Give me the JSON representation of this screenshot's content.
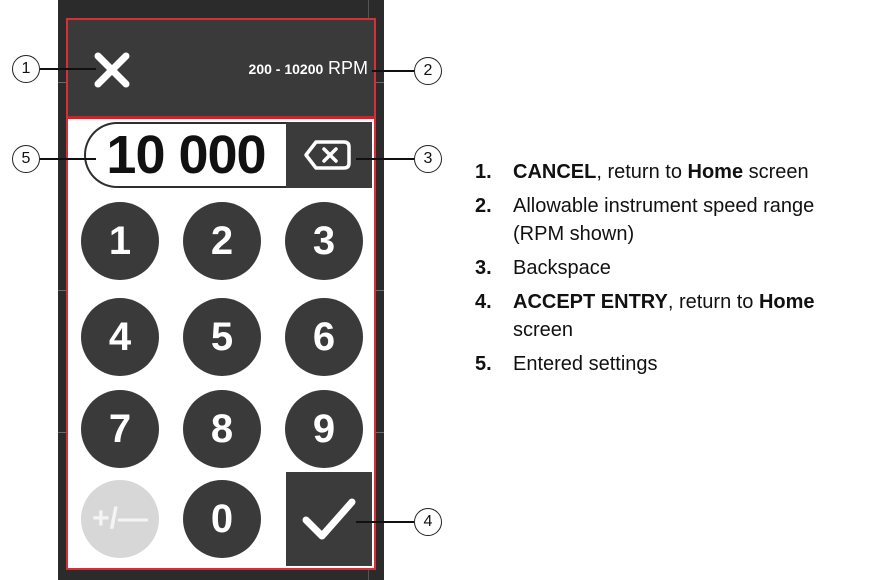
{
  "keypad": {
    "range_values": "200 - 10200",
    "range_unit": "RPM",
    "entry_value": "10 000",
    "keys": [
      "1",
      "2",
      "3",
      "4",
      "5",
      "6",
      "7",
      "8",
      "9",
      "+/—",
      "0"
    ],
    "icons": {
      "cancel": "close-icon",
      "backspace": "backspace-icon",
      "accept": "checkmark-icon"
    }
  },
  "callouts": [
    "1",
    "2",
    "3",
    "4",
    "5"
  ],
  "legend": {
    "items": [
      {
        "num": "1.",
        "bold1": "CANCEL",
        "text1": ", return to ",
        "bold2": "Home",
        "text2": " screen"
      },
      {
        "num": "2.",
        "text1": "Allowable instrument speed range (RPM shown)"
      },
      {
        "num": "3.",
        "text1": "Backspace"
      },
      {
        "num": "4.",
        "bold1": "ACCEPT ENTRY",
        "text1": ", return to ",
        "bold2": "Home",
        "text2": " screen"
      },
      {
        "num": "5.",
        "text1": "Entered settings"
      }
    ]
  },
  "colors": {
    "frame": "#d62f36",
    "dark": "#3a3a3a",
    "disabled": "#d7d7d7"
  }
}
